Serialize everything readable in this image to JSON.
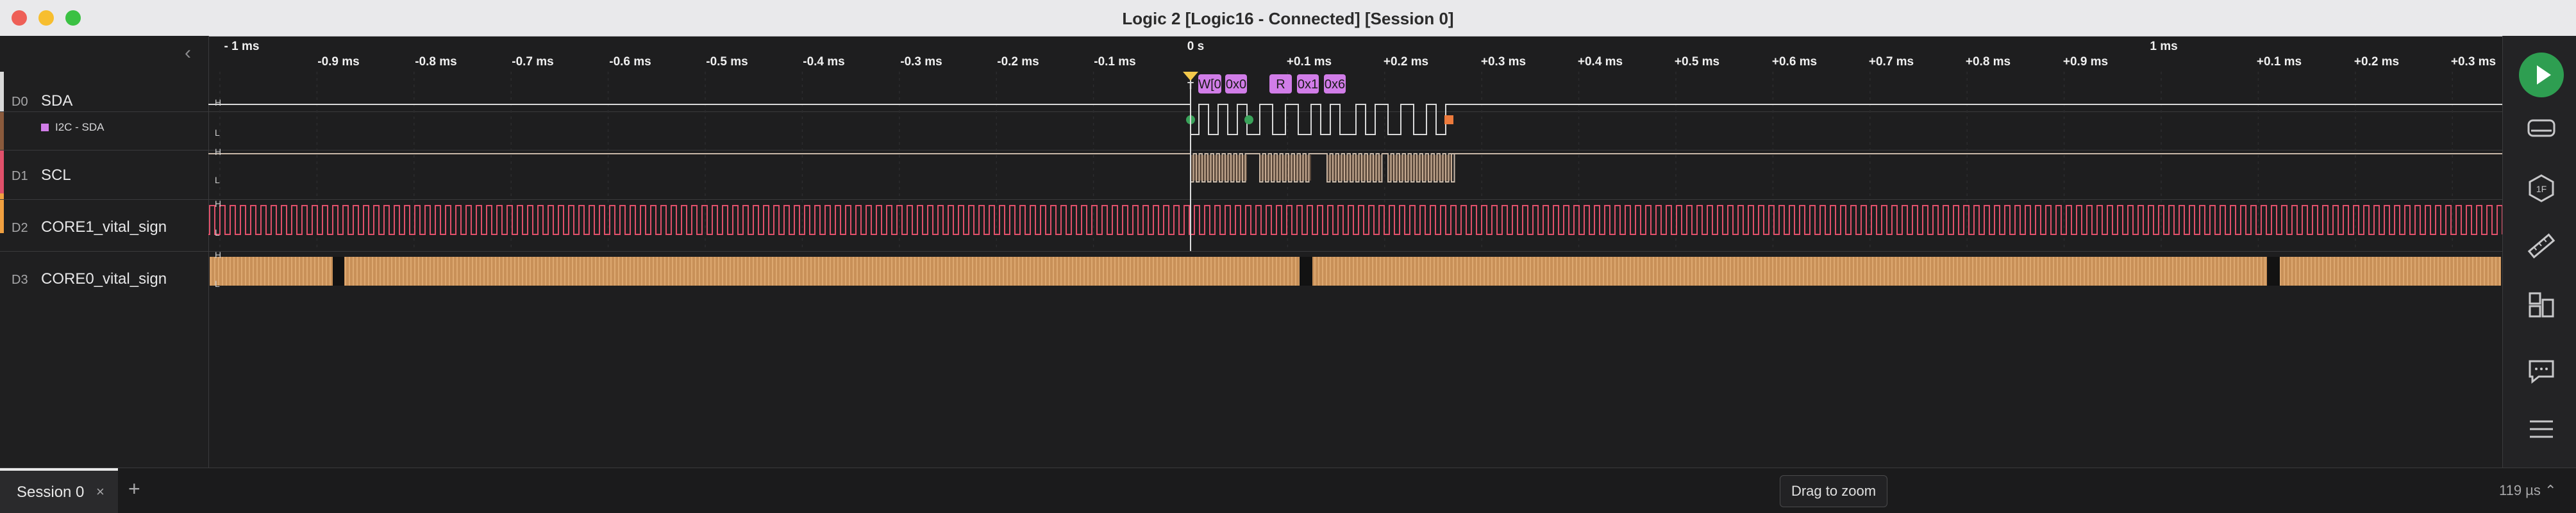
{
  "window": {
    "title": "Logic 2 [Logic16 - Connected] [Session 0]",
    "traffic_lights": {
      "close": "#ee5f57",
      "minimize": "#f7be2f",
      "maximize": "#3bc143"
    }
  },
  "time_ruler": {
    "ms_labels": [
      "- 1 ms",
      "0 s",
      "1 ms"
    ],
    "ticks": [
      "-0.9 ms",
      "-0.8 ms",
      "-0.7 ms",
      "-0.6 ms",
      "-0.5 ms",
      "-0.4 ms",
      "-0.3 ms",
      "-0.2 ms",
      "-0.1 ms",
      "+0.1 ms",
      "+0.2 ms",
      "+0.3 ms",
      "+0.4 ms",
      "+0.5 ms",
      "+0.6 ms",
      "+0.7 ms",
      "+0.8 ms",
      "+0.9 ms",
      "+0.1 ms",
      "+0.2 ms",
      "+0.3 ms"
    ],
    "trigger_label": "T"
  },
  "channels": [
    {
      "num": "D0",
      "name": "SDA",
      "color": "#d9d9d9"
    },
    {
      "num": "D1",
      "name": "SCL",
      "color": "#8a5a3c"
    },
    {
      "num": "D2",
      "name": "CORE1_vital_sign",
      "color": "#e0506a"
    },
    {
      "num": "D3",
      "name": "CORE0_vital_sign",
      "color": "#f0a040"
    }
  ],
  "analyzer": {
    "label": "I2C - SDA",
    "color": "#d17de8"
  },
  "level_labels": {
    "high": "H",
    "low": "L"
  },
  "i2c_frames": [
    "W[0",
    "0x0",
    "R",
    "0x1",
    "0x6"
  ],
  "bottom": {
    "session_tab": "Session 0",
    "close_glyph": "×",
    "add_glyph": "+",
    "zoom_hint": "Drag to zoom",
    "sample_rate": "119 µs ⌃"
  },
  "rail": {
    "icons": [
      "play-icon",
      "analyzers-icon",
      "hex-extensions-icon",
      "measure-icon",
      "layout-icon",
      "chat-icon",
      "menu-icon"
    ],
    "accent": "#2e9e51"
  }
}
